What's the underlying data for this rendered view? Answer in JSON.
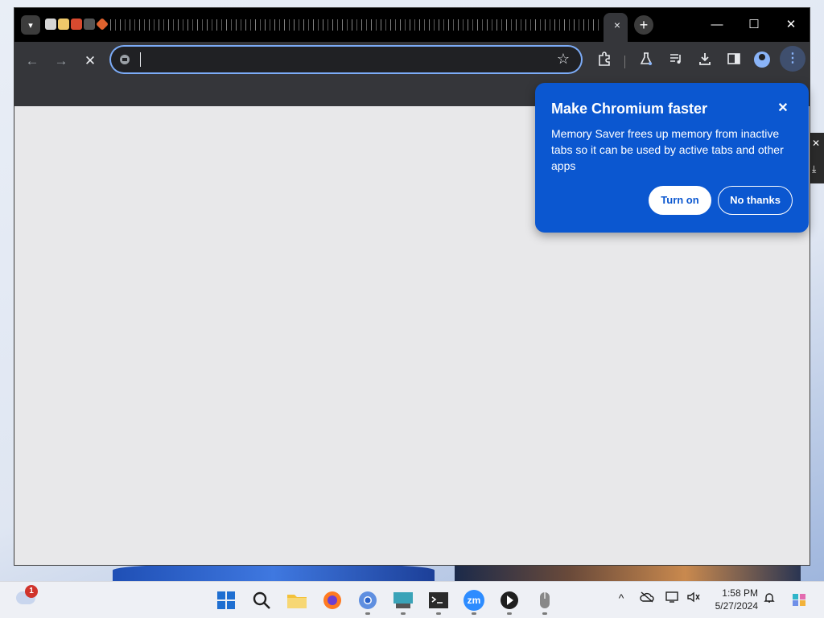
{
  "browser": {
    "tab_search_icon": "chevron-down-icon",
    "active_tab_close": "×",
    "new_tab_label": "+",
    "window_controls": {
      "minimize": "—",
      "maximize": "☐",
      "close": "✕"
    },
    "toolbar": {
      "back": "←",
      "forward": "→",
      "stop": "✕",
      "omnibox_value": "",
      "bookmark_star": "☆",
      "extensions_icon": "puzzle-icon",
      "labs_icon": "flask-icon",
      "media_icon": "media-controls-icon",
      "download_icon": "download-icon",
      "side_panel_icon": "side-panel-icon",
      "menu": "⋮"
    }
  },
  "popup": {
    "title": "Make Chromium faster",
    "body": "Memory Saver frees up memory from inactive tabs so it can be used by active tabs and other apps",
    "close": "✕",
    "primary_button": "Turn on",
    "secondary_button": "No thanks"
  },
  "taskbar": {
    "weather_badge": "1",
    "apps": [
      {
        "name": "start",
        "icon": "windows-icon"
      },
      {
        "name": "search",
        "icon": "search-icon"
      },
      {
        "name": "file-explorer",
        "icon": "folder-icon"
      },
      {
        "name": "firefox",
        "icon": "firefox-icon"
      },
      {
        "name": "chromium",
        "icon": "chromium-icon"
      },
      {
        "name": "keyboard-app",
        "icon": "keyboard-icon"
      },
      {
        "name": "terminal",
        "icon": "terminal-icon"
      },
      {
        "name": "zoom",
        "icon": "zoom-icon",
        "label": "zm"
      },
      {
        "name": "media-player",
        "icon": "play-icon"
      },
      {
        "name": "mouse-app",
        "icon": "mouse-icon"
      }
    ],
    "tray": {
      "chevron": "^",
      "time": "1:58 PM",
      "date": "5/27/2024"
    }
  },
  "colors": {
    "popup_bg": "#0b57d0",
    "omnibox_focus": "#7cacf8",
    "titlebar": "#000000",
    "toolbar": "#35363a",
    "content_bg": "#e8e8ea"
  }
}
